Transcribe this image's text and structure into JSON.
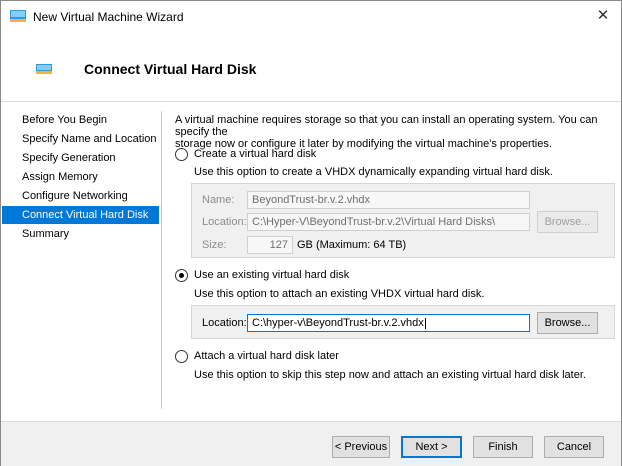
{
  "window": {
    "title": "New Virtual Machine Wizard",
    "close_glyph": "✕"
  },
  "header": {
    "title": "Connect Virtual Hard Disk"
  },
  "nav": {
    "items": [
      {
        "label": "Before You Begin",
        "active": false
      },
      {
        "label": "Specify Name and Location",
        "active": false
      },
      {
        "label": "Specify Generation",
        "active": false
      },
      {
        "label": "Assign Memory",
        "active": false
      },
      {
        "label": "Configure Networking",
        "active": false
      },
      {
        "label": "Connect Virtual Hard Disk",
        "active": true
      },
      {
        "label": "Summary",
        "active": false
      }
    ]
  },
  "content": {
    "description_line1": "A virtual machine requires storage so that you can install an operating system. You can specify the",
    "description_line2": "storage now or configure it later by modifying the virtual machine's properties.",
    "option_create": {
      "label": "Create a virtual hard disk",
      "description": "Use this option to create a VHDX dynamically expanding virtual hard disk.",
      "selected": false,
      "name_label": "Name:",
      "name_value": "BeyondTrust-br.v.2.vhdx",
      "location_label": "Location:",
      "location_value": "C:\\Hyper-V\\BeyondTrust-br.v.2\\Virtual Hard Disks\\",
      "browse_label": "Browse...",
      "size_label": "Size:",
      "size_value": "127",
      "size_unit": "GB (Maximum: 64 TB)"
    },
    "option_existing": {
      "label": "Use an existing virtual hard disk",
      "description": "Use this option to attach an existing VHDX virtual hard disk.",
      "selected": true,
      "location_label": "Location:",
      "location_value": "C:\\hyper-v\\BeyondTrust-br.v.2.vhdx",
      "browse_label": "Browse..."
    },
    "option_later": {
      "label": "Attach a virtual hard disk later",
      "description": "Use this option to skip this step now and attach an existing virtual hard disk later.",
      "selected": false
    }
  },
  "footer": {
    "previous_label": "< Previous",
    "next_label": "Next >",
    "finish_label": "Finish",
    "cancel_label": "Cancel"
  },
  "colors": {
    "accent": "#0078d7",
    "footer_bg": "#f0f0f0"
  },
  "icons": {
    "title": "hyper-v-vm-icon",
    "header": "hyper-v-vm-icon",
    "close": "close-icon"
  }
}
